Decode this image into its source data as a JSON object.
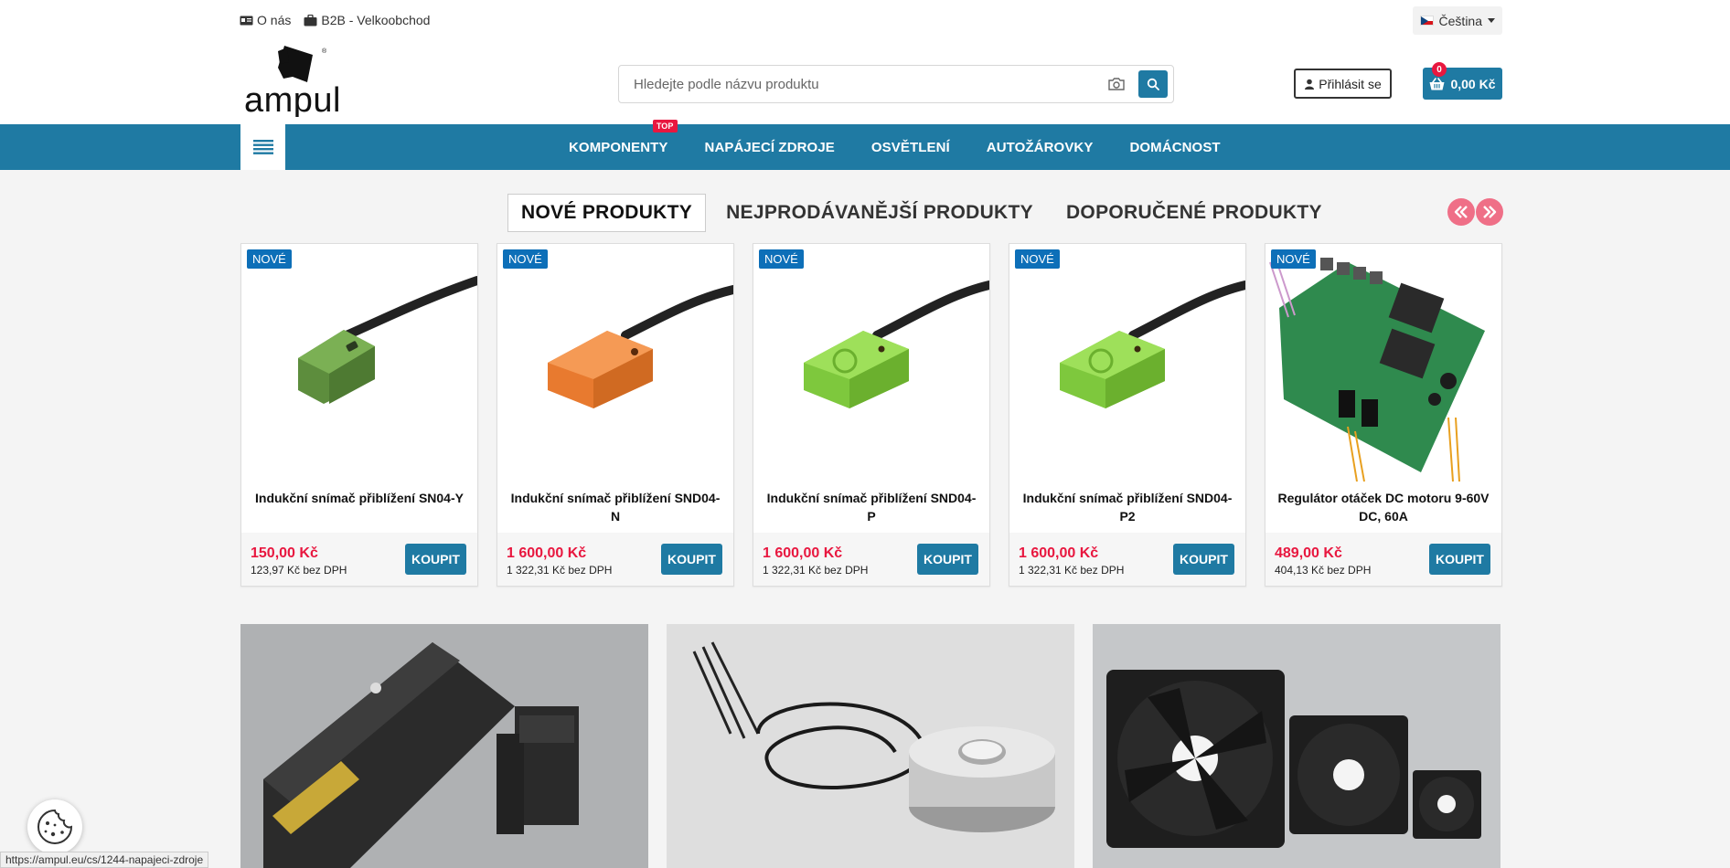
{
  "topbar": {
    "links": [
      {
        "label": "O nás",
        "icon": "id-card-icon"
      },
      {
        "label": "B2B - Velkoobchod",
        "icon": "briefcase-icon"
      }
    ],
    "language": "Čeština"
  },
  "logo": {
    "text": "ampul"
  },
  "search": {
    "placeholder": "Hledejte podle názvu produktu"
  },
  "account": {
    "login_label": "Přihlásit se"
  },
  "cart": {
    "count": "0",
    "total": "0,00 Kč"
  },
  "nav": {
    "items": [
      {
        "label": "KOMPONENTY",
        "badge": "TOP"
      },
      {
        "label": "NAPÁJECÍ ZDROJE"
      },
      {
        "label": "OSVĚTLENÍ"
      },
      {
        "label": "AUTOŽÁROVKY"
      },
      {
        "label": "DOMÁCNOST"
      }
    ]
  },
  "tabs": [
    {
      "label": "NOVÉ PRODUKTY",
      "active": true
    },
    {
      "label": "NEJPRODÁVANĚJŠÍ PRODUKTY"
    },
    {
      "label": "DOPORUČENÉ PRODUKTY"
    }
  ],
  "products": [
    {
      "badge": "NOVÉ",
      "name": "Indukční snímač přiblížení SN04-Y",
      "price": "150,00 Kč",
      "price_net": "123,97 Kč bez DPH",
      "buy_label": "KOUPIT",
      "color": "#6fa04a"
    },
    {
      "badge": "NOVÉ",
      "name": "Indukční snímač přiblížení SND04-N",
      "price": "1 600,00 Kč",
      "price_net": "1 322,31 Kč bez DPH",
      "buy_label": "KOUPIT",
      "color": "#f2843a"
    },
    {
      "badge": "NOVÉ",
      "name": "Indukční snímač přiblížení SND04-P",
      "price": "1 600,00 Kč",
      "price_net": "1 322,31 Kč bez DPH",
      "buy_label": "KOUPIT",
      "color": "#8fd24a"
    },
    {
      "badge": "NOVÉ",
      "name": "Indukční snímač přiblížení SND04-P2",
      "price": "1 600,00 Kč",
      "price_net": "1 322,31 Kč bez DPH",
      "buy_label": "KOUPIT",
      "color": "#8fd24a"
    },
    {
      "badge": "NOVÉ",
      "name": "Regulátor otáček DC motoru 9-60V DC, 60A",
      "price": "489,00 Kč",
      "price_net": "404,13 Kč bez DPH",
      "buy_label": "KOUPIT",
      "color": "#2e8b4e"
    }
  ],
  "status_url": "https://ampul.eu/cs/1244-napajeci-zdroje",
  "colors": {
    "primary": "#1f7aa3",
    "accent": "#e8173f",
    "badge": "#0d6fb8",
    "arrow": "#ef6f87"
  }
}
